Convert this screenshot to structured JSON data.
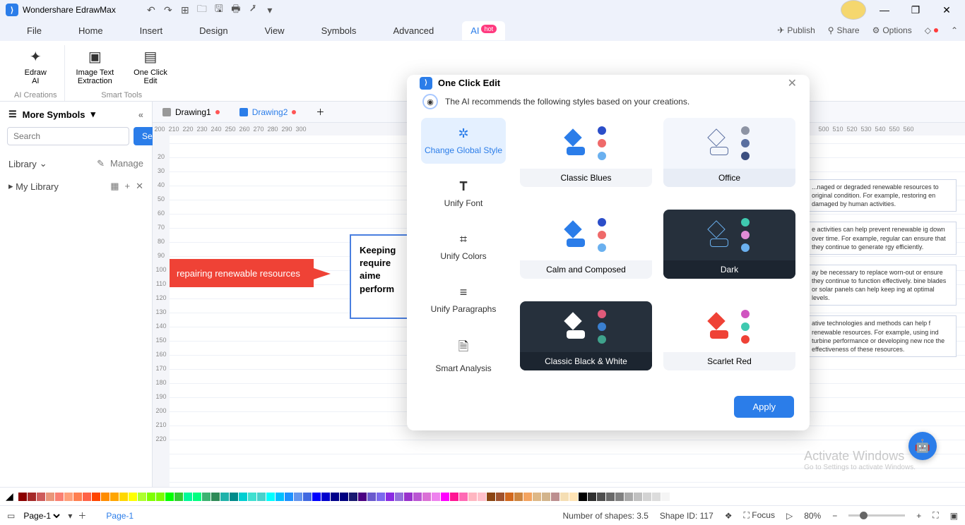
{
  "app": {
    "title": "Wondershare EdrawMax"
  },
  "menubar": {
    "items": [
      "File",
      "Home",
      "Insert",
      "Design",
      "View",
      "Symbols",
      "Advanced",
      "AI"
    ],
    "active": 7,
    "right": {
      "publish": "Publish",
      "share": "Share",
      "options": "Options"
    }
  },
  "ribbon": {
    "group1_label": "AI Creations",
    "group2_label": "Smart Tools",
    "btns": {
      "edraw_ai": "Edraw\nAI",
      "img_txt": "Image Text\nExtraction",
      "one_click": "One Click\nEdit"
    }
  },
  "sidebar": {
    "title": "More Symbols",
    "search_placeholder": "Search",
    "search_btn": "Search",
    "library": "Library",
    "manage": "Manage",
    "mylib": "My Library"
  },
  "doctabs": {
    "d1": "Drawing1",
    "d2": "Drawing2"
  },
  "canvas": {
    "blue_text": "Keeping\nrequire\naime\nperform",
    "red_text": "repairing renewable resources",
    "para1": "...naged or degraded renewable resources to original condition. For example, restoring en damaged by human activities.",
    "para2": "e activities can help prevent renewable ig down over time. For example, regular can ensure that they continue to generate rgy efficiently.",
    "para3": "ay be necessary to replace worn-out or ensure they continue to function effectively. bine blades or solar panels can help keep ing at optimal levels.",
    "para4": "ative technologies and methods can help f renewable resources. For example, using ind turbine performance or developing new nce the effectiveness of these resources."
  },
  "dialog": {
    "title": "One Click Edit",
    "hint": "The AI recommends the following styles based on your creations.",
    "left": {
      "change_style": "Change Global Style",
      "unify_font": "Unify Font",
      "unify_colors": "Unify Colors",
      "unify_para": "Unify Paragraphs",
      "smart": "Smart Analysis"
    },
    "styles": {
      "classic_blues": "Classic Blues",
      "office": "Office",
      "calm": "Calm and Composed",
      "dark": "Dark",
      "cbw": "Classic Black & White",
      "scarlet": "Scarlet Red"
    },
    "apply": "Apply"
  },
  "status": {
    "page_sel": "Page-1",
    "page_lbl": "Page-1",
    "shapes": "Number of shapes: 3.5",
    "shape_id": "Shape ID: 117",
    "focus": "Focus",
    "zoom": "80%"
  },
  "watermark": {
    "l1": "Activate Windows",
    "l2": "Go to Settings to activate Windows."
  },
  "ruler_h": [
    200,
    210,
    220,
    230,
    240,
    250,
    260,
    270,
    280,
    290,
    300,
    "",
    "",
    "",
    "",
    "",
    "",
    "",
    "",
    "",
    "",
    "",
    "",
    "",
    "",
    "",
    "",
    "",
    "",
    "",
    "",
    "",
    "",
    "",
    "",
    "",
    "",
    "",
    "",
    "",
    "",
    "",
    "",
    "",
    "",
    "",
    "",
    500,
    510,
    520,
    530,
    540,
    550,
    560
  ],
  "ruler_v": [
    "",
    20,
    30,
    40,
    50,
    60,
    70,
    80,
    90,
    100,
    110,
    120,
    130,
    140,
    150,
    160,
    170,
    180,
    190,
    200,
    210,
    220
  ]
}
